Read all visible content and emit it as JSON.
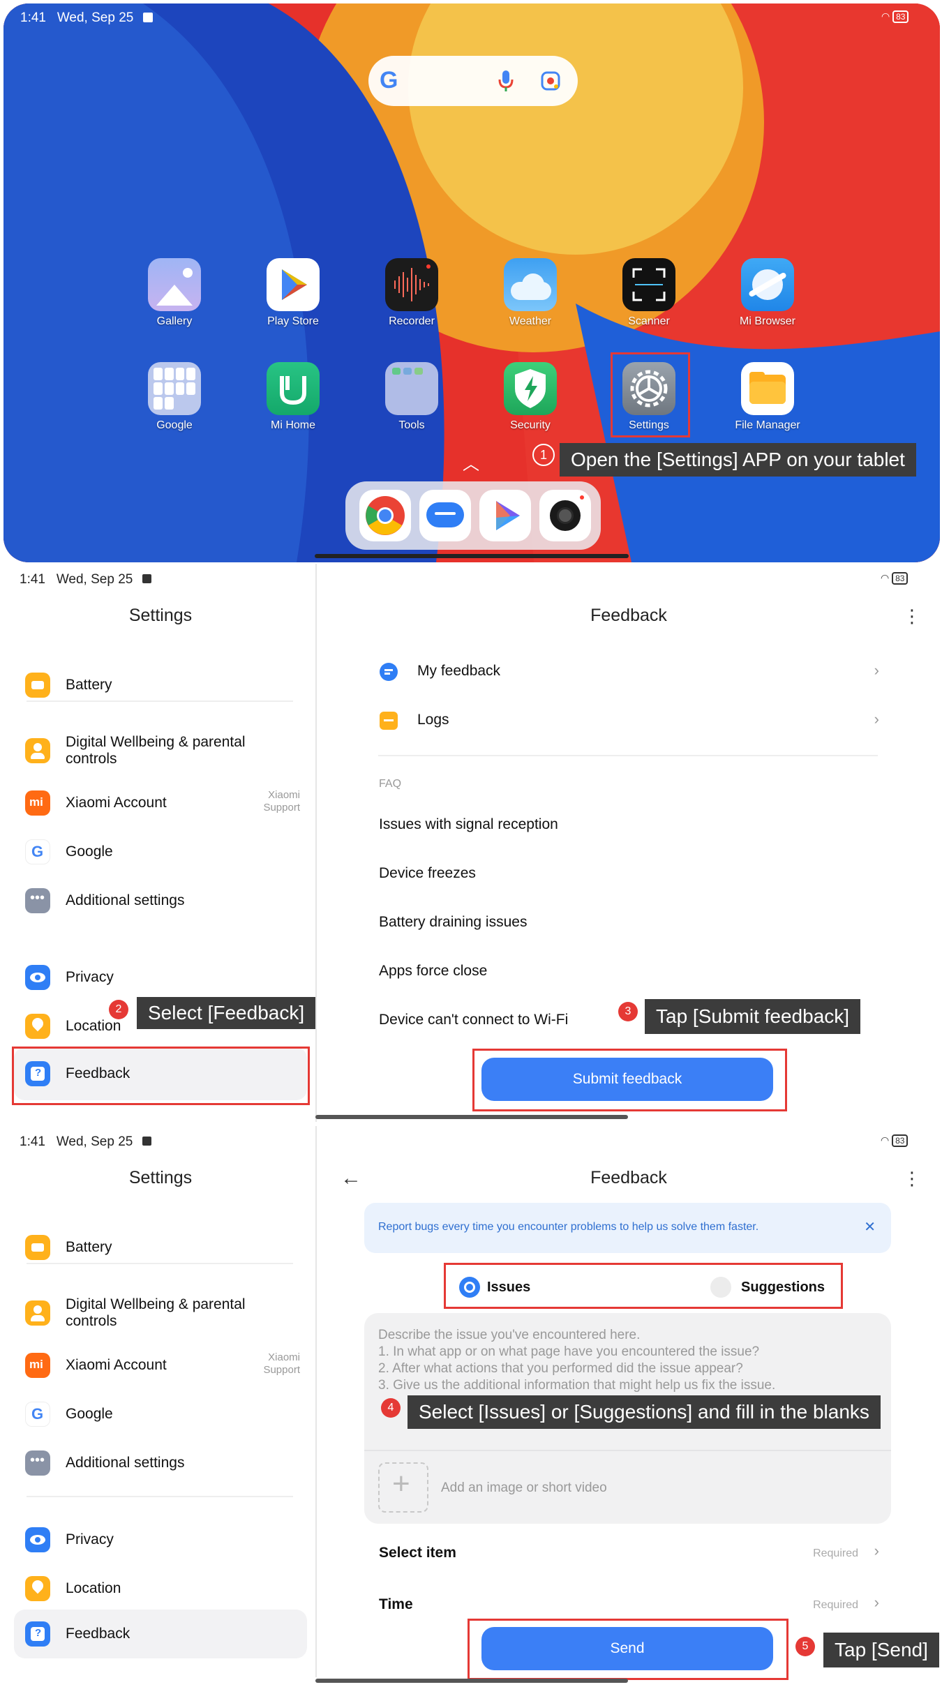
{
  "panel1": {
    "status": {
      "time": "1:41",
      "date": "Wed, Sep 25",
      "battery": "83"
    },
    "apps_row1": [
      "Gallery",
      "Play Store",
      "Recorder",
      "Weather",
      "Scanner",
      "Mi Browser"
    ],
    "apps_row2": [
      "Google",
      "Mi Home",
      "Tools",
      "Security",
      "Settings",
      "File Manager"
    ],
    "step_number": "1",
    "instruction": "Open the [Settings] APP on your tablet"
  },
  "panel2": {
    "status": {
      "time": "1:41",
      "date": "Wed, Sep 25",
      "battery": "83"
    },
    "settings_title": "Settings",
    "settings_items": [
      "Battery",
      "Digital Wellbeing & parental controls",
      "Xiaomi Account",
      "Google",
      "Additional settings",
      "Privacy",
      "Location",
      "Feedback"
    ],
    "xiaomi_sub": "Xiaomi Support",
    "feedback_title": "Feedback",
    "my_feedback": "My feedback",
    "logs": "Logs",
    "faq_label": "FAQ",
    "faq": [
      "Issues with signal reception",
      "Device freezes",
      "Battery draining issues",
      "Apps force close",
      "Device can't connect to Wi-Fi"
    ],
    "submit_button": "Submit feedback",
    "step2": "2",
    "instruction2": "Select [Feedback]",
    "step3": "3",
    "instruction3": "Tap [Submit feedback]"
  },
  "panel3": {
    "status": {
      "time": "1:41",
      "date": "Wed, Sep 25",
      "battery": "83"
    },
    "settings_title": "Settings",
    "feedback_title": "Feedback",
    "banner": "Report bugs every time you encounter problems to help us solve them faster.",
    "radio_issues": "Issues",
    "radio_suggestions": "Suggestions",
    "placeholder_lines": [
      "Describe the issue you've encountered here.",
      "1. In what app or on what page have you encountered the issue?",
      "2. After what actions that you performed did the issue appear?",
      "3. Give us the additional information that might help us fix the issue."
    ],
    "add_media": "Add an image or short video",
    "select_item": "Select item",
    "time_label": "Time",
    "required": "Required",
    "send_button": "Send",
    "step4": "4",
    "instruction4": "Select [Issues] or [Suggestions] and fill in the blanks",
    "step5": "5",
    "instruction5": "Tap [Send]"
  }
}
